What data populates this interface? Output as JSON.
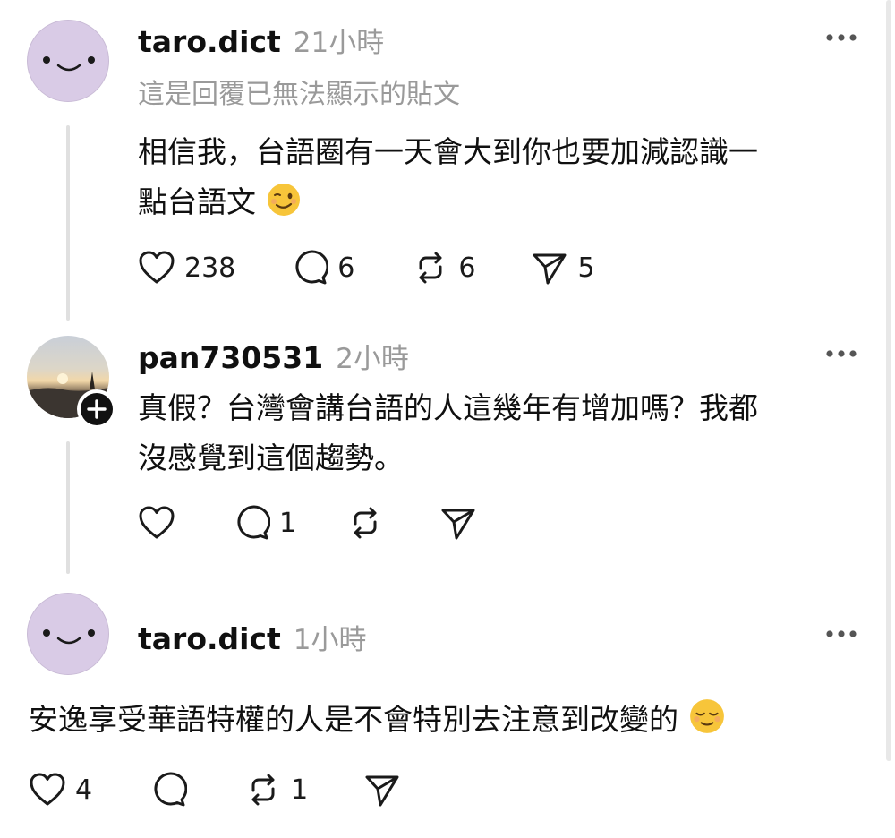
{
  "posts": [
    {
      "username": "taro.dict",
      "time": "21小時",
      "subtitle": "這是回覆已無法顯示的貼文",
      "text_line1": "相信我，台語圈有一天會大到你也要加減認識一",
      "text_line2": "點台語文",
      "emoji": "winking-face",
      "likes": "238",
      "replies": "6",
      "reposts": "6",
      "shares": "5"
    },
    {
      "username": "pan730531",
      "time": "2小時",
      "text_line1": "真假？台灣會講台語的人這幾年有增加嗎？我都",
      "text_line2": "沒感覺到這個趨勢。",
      "replies": "1"
    },
    {
      "username": "taro.dict",
      "time": "1小時",
      "text_line1": "安逸享受華語特權的人是不會特別去注意到改變的",
      "emoji": "relieved-face",
      "likes": "4",
      "reposts": "1"
    }
  ]
}
